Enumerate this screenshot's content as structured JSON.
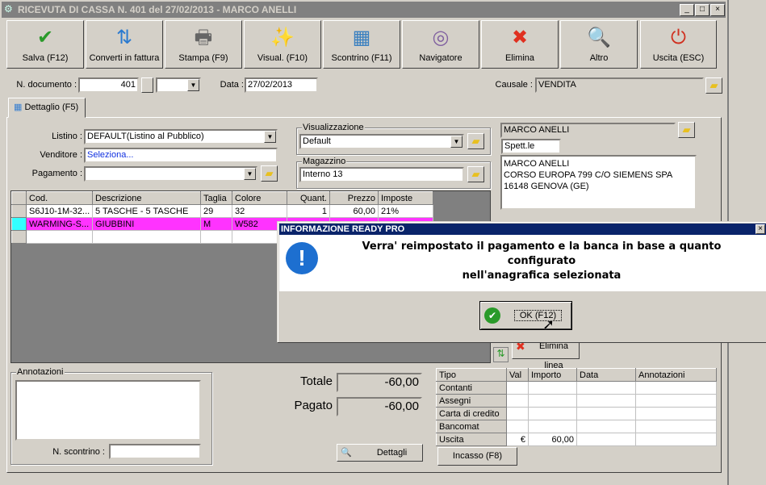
{
  "window": {
    "title": "RICEVUTA DI CASSA N. 401 del 27/02/2013 - MARCO ANELLI",
    "minimize": "_",
    "maximize": "□",
    "close": "×"
  },
  "toolbar": [
    {
      "label": "Salva (F12)",
      "icon": "check-icon",
      "glyph": "✔",
      "color": "#2a9a2a"
    },
    {
      "label": "Converti in fattura",
      "icon": "convert-icon",
      "glyph": "⇅",
      "color": "#2a7ad0"
    },
    {
      "label": "Stampa (F9)",
      "icon": "printer-icon",
      "glyph": "🖶",
      "color": "#666666"
    },
    {
      "label": "Visual. (F10)",
      "icon": "magic-wand-icon",
      "glyph": "✨",
      "color": "#d0a000"
    },
    {
      "label": "Scontrino (F11)",
      "icon": "cash-register-icon",
      "glyph": "▦",
      "color": "#3a80c0"
    },
    {
      "label": "Navigatore",
      "icon": "compass-icon",
      "glyph": "◎",
      "color": "#8060a0"
    },
    {
      "label": "Elimina",
      "icon": "delete-x-icon",
      "glyph": "✖",
      "color": "#e03020"
    },
    {
      "label": "Altro",
      "icon": "search-book-icon",
      "glyph": "🔍",
      "color": "#2060c0"
    },
    {
      "label": "Uscita (ESC)",
      "icon": "power-icon",
      "glyph": "⏻",
      "color": "#d03020"
    }
  ],
  "header": {
    "doc_label": "N. documento :",
    "doc_value": "401",
    "date_label": "Data :",
    "date_value": "27/02/2013",
    "causale_label": "Causale :",
    "causale_value": "VENDITA"
  },
  "tab": {
    "label": "Dettaglio (F5)"
  },
  "form": {
    "listino_label": "Listino :",
    "listino_value": "DEFAULT(Listino al Pubblico)",
    "venditore_label": "Venditore :",
    "venditore_value": "Seleziona...",
    "pagamento_label": "Pagamento :",
    "pagamento_value": "",
    "visual_label": "Visualizzazione",
    "visual_value": "Default",
    "magazzino_label": "Magazzino",
    "magazzino_value": "Interno 13"
  },
  "customer": {
    "name": "MARCO ANELLI",
    "title": "Spett.le",
    "address": [
      "MARCO ANELLI",
      "CORSO EUROPA 799 C/O SIEMENS SPA",
      "16148 GENOVA (GE)"
    ]
  },
  "grid": {
    "columns": [
      "Cod.",
      "Descrizione",
      "Taglia",
      "Colore",
      "Quant.",
      "Prezzo",
      "Imposte"
    ],
    "rows": [
      [
        "S6J10-1M-32...",
        "5 TASCHE - 5 TASCHE",
        "29",
        "32",
        "1",
        "60,00",
        "21%"
      ],
      [
        "WARMING-S...",
        "GIUBBINI",
        "M",
        "W582",
        "",
        "",
        ""
      ],
      [
        "",
        "",
        "",
        "",
        "",
        "",
        ""
      ]
    ],
    "highlight": "#ff33ff",
    "indicator": "#33ffff"
  },
  "dialog": {
    "title": "INFORMAZIONE READY PRO",
    "message_line1": "Verra' reimpostato il pagamento e la banca in base a quanto configurato",
    "message_line2": "nell'anagrafica selezionata",
    "ok": "OK (F12)",
    "close": "×"
  },
  "elimina_linea": "Elimina linea",
  "notes": {
    "label": "Annotazioni",
    "value": "",
    "scontrino_label": "N. scontrino :",
    "scontrino_value": ""
  },
  "totals": {
    "totale_label": "Totale",
    "totale": "-60,00",
    "pagato_label": "Pagato",
    "pagato": "-60,00",
    "dettagli": "Dettagli"
  },
  "payments": {
    "columns": [
      "Tipo",
      "Val",
      "Importo",
      "Data",
      "Annotazioni"
    ],
    "rows": [
      [
        "Contanti",
        "",
        "",
        "",
        ""
      ],
      [
        "Assegni",
        "",
        "",
        "",
        ""
      ],
      [
        "Carta di credito",
        "",
        "",
        "",
        ""
      ],
      [
        "Bancomat",
        "",
        "",
        "",
        ""
      ],
      [
        "Uscita",
        "€",
        "60,00",
        "",
        ""
      ]
    ],
    "incasso": "Incasso (F8)"
  }
}
